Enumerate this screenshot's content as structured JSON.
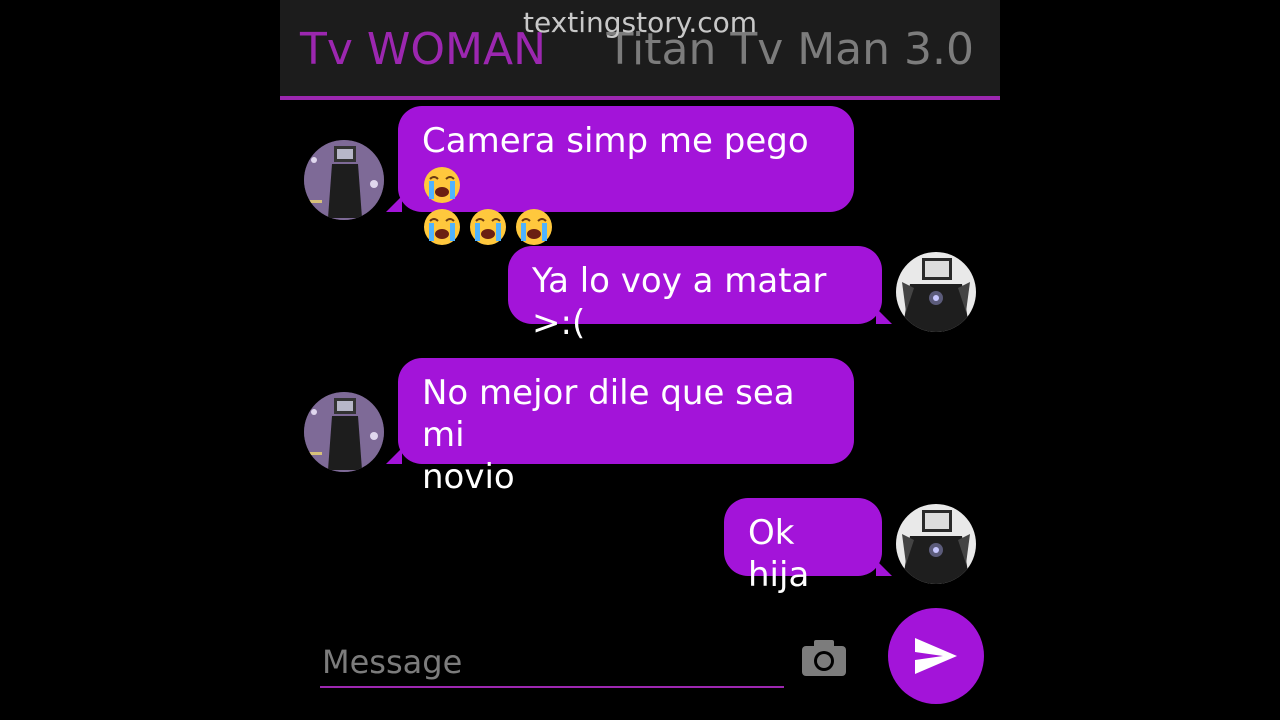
{
  "watermark": "textingstory.com",
  "header": {
    "contact_left": "Tv WOMAN",
    "contact_right": "Titan Tv Man 3.0"
  },
  "messages": [
    {
      "side": "left",
      "text_line1": "Camera simp me pego",
      "emojis": [
        "crying-face",
        "crying-face",
        "crying-face",
        "crying-face"
      ]
    },
    {
      "side": "right",
      "text": "Ya lo voy a matar >:("
    },
    {
      "side": "left",
      "text_line1": "No mejor dile que sea mi",
      "text_line2": "novio"
    },
    {
      "side": "right",
      "text": "Ok hija"
    }
  ],
  "composer": {
    "placeholder": "Message"
  },
  "icons": {
    "camera": "camera-icon",
    "send": "send-icon"
  },
  "colors": {
    "accent": "#a314d9",
    "header_bg": "#1c1c1c",
    "tab_active": "#9c27b0",
    "tab_inactive": "#7c7c7c"
  }
}
